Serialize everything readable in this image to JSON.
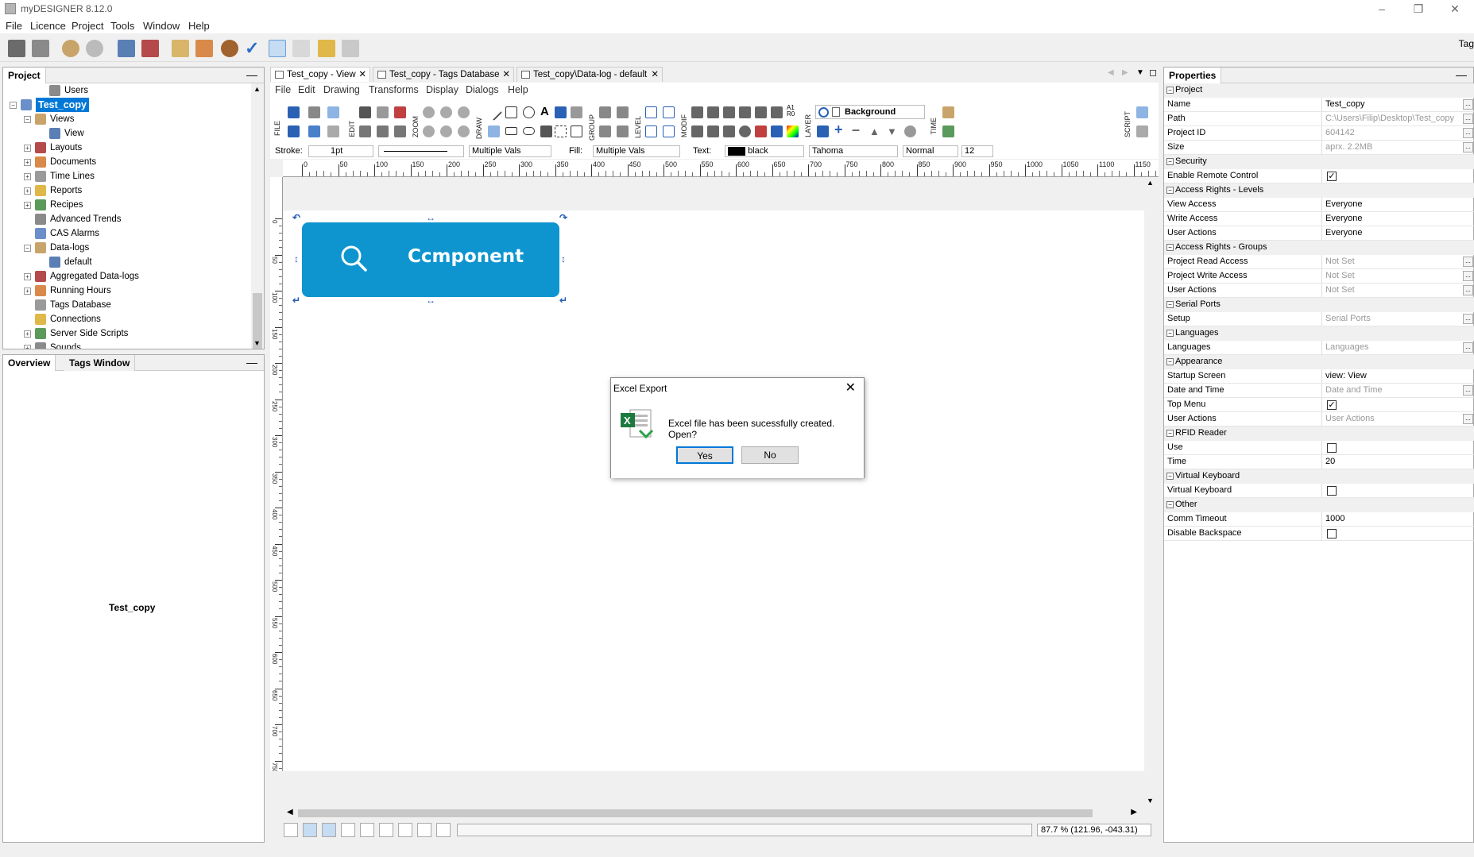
{
  "window": {
    "title": "myDESIGNER 8.12.0"
  },
  "menu": [
    "File",
    "Licence",
    "Project",
    "Tools",
    "Window",
    "Help"
  ],
  "toolbar": {
    "tag_label": "Tag"
  },
  "project_panel": {
    "tab": "Project",
    "tree": [
      {
        "label": "Users",
        "indent": 2,
        "expand": ""
      },
      {
        "label": "Test_copy",
        "indent": 0,
        "expand": "-",
        "selected": true
      },
      {
        "label": "Views",
        "indent": 1,
        "expand": "-"
      },
      {
        "label": "View",
        "indent": 2,
        "expand": ""
      },
      {
        "label": "Layouts",
        "indent": 1,
        "expand": "+"
      },
      {
        "label": "Documents",
        "indent": 1,
        "expand": "+"
      },
      {
        "label": "Time Lines",
        "indent": 1,
        "expand": "+"
      },
      {
        "label": "Reports",
        "indent": 1,
        "expand": "+"
      },
      {
        "label": "Recipes",
        "indent": 1,
        "expand": "+"
      },
      {
        "label": "Advanced Trends",
        "indent": 1,
        "expand": ""
      },
      {
        "label": "CAS Alarms",
        "indent": 1,
        "expand": ""
      },
      {
        "label": "Data-logs",
        "indent": 1,
        "expand": "-"
      },
      {
        "label": "default",
        "indent": 2,
        "expand": ""
      },
      {
        "label": "Aggregated Data-logs",
        "indent": 1,
        "expand": "+"
      },
      {
        "label": "Running Hours",
        "indent": 1,
        "expand": "+"
      },
      {
        "label": "Tags Database",
        "indent": 1,
        "expand": ""
      },
      {
        "label": "Connections",
        "indent": 1,
        "expand": ""
      },
      {
        "label": "Server Side Scripts",
        "indent": 1,
        "expand": "+"
      },
      {
        "label": "Sounds",
        "indent": 1,
        "expand": "+"
      }
    ]
  },
  "overview_panel": {
    "tabs": [
      "Overview",
      "Tags Window"
    ],
    "content": "Test_copy"
  },
  "doc_tabs": [
    {
      "label": "Test_copy - View",
      "active": true
    },
    {
      "label": "Test_copy - Tags Database",
      "active": false
    },
    {
      "label": "Test_copy\\Data-log - default",
      "active": false
    }
  ],
  "inner_menu": [
    "File",
    "Edit",
    "Drawing",
    "Transforms",
    "Display",
    "Dialogs",
    "Help"
  ],
  "draw_groups": [
    "FILE",
    "EDIT",
    "ZOOM",
    "DRAW",
    "GROUP",
    "LEVEL",
    "MODIF",
    "LAYER",
    "TIME",
    "SCRIPT"
  ],
  "layer_name": "Background",
  "style_bar": {
    "stroke_label": "Stroke:",
    "stroke_width": "1pt",
    "stroke_vals": "Multiple Vals",
    "fill_label": "Fill:",
    "fill_vals": "Multiple Vals",
    "text_label": "Text:",
    "text_color": "black",
    "font": "Tahoma",
    "weight": "Normal",
    "size": "12"
  },
  "ruler_ticks": [
    "0",
    "50",
    "100",
    "150",
    "200",
    "250",
    "300",
    "350",
    "400",
    "450",
    "500",
    "550",
    "600",
    "650",
    "700",
    "750",
    "800",
    "850",
    "900",
    "950",
    "1000",
    "1050",
    "1100",
    "1150",
    "1200"
  ],
  "vruler_ticks": [
    "0",
    "50",
    "100",
    "150",
    "200",
    "250",
    "300",
    "350",
    "400",
    "450",
    "500",
    "550",
    "600",
    "650",
    "700",
    "750"
  ],
  "component": {
    "label": "Ccmponent",
    "color": "#0e95cf"
  },
  "status": {
    "zoom": "87.7 % (121.96, -043.31)"
  },
  "properties": {
    "tab": "Properties",
    "rows": [
      {
        "type": "cat",
        "label": "Project"
      },
      {
        "type": "row",
        "key": "Name",
        "value": "Test_copy",
        "dots": true
      },
      {
        "type": "row",
        "key": "Path",
        "value": "C:\\Users\\Filip\\Desktop\\Test_copy",
        "grey": true,
        "dots": true
      },
      {
        "type": "row",
        "key": "Project ID",
        "value": "604142",
        "grey": true,
        "dots": true
      },
      {
        "type": "row",
        "key": "Size",
        "value": "aprx. 2.2MB",
        "grey": true,
        "dots": true
      },
      {
        "type": "cat",
        "label": "Security"
      },
      {
        "type": "check",
        "key": "Enable Remote Control",
        "checked": true
      },
      {
        "type": "cat",
        "label": "Access Rights - Levels"
      },
      {
        "type": "row",
        "key": "View Access",
        "value": "Everyone"
      },
      {
        "type": "row",
        "key": "Write Access",
        "value": "Everyone"
      },
      {
        "type": "row",
        "key": "User Actions",
        "value": "Everyone"
      },
      {
        "type": "cat",
        "label": "Access Rights - Groups"
      },
      {
        "type": "row",
        "key": "Project Read Access",
        "value": "Not Set",
        "grey": true,
        "dots": true
      },
      {
        "type": "row",
        "key": "Project Write Access",
        "value": "Not Set",
        "grey": true,
        "dots": true
      },
      {
        "type": "row",
        "key": "User Actions",
        "value": "Not Set",
        "grey": true,
        "dots": true
      },
      {
        "type": "cat",
        "label": "Serial Ports"
      },
      {
        "type": "row",
        "key": "Setup",
        "value": "Serial Ports",
        "grey": true,
        "dots": true
      },
      {
        "type": "cat",
        "label": "Languages"
      },
      {
        "type": "row",
        "key": "Languages",
        "value": "Languages",
        "grey": true,
        "dots": true
      },
      {
        "type": "cat",
        "label": "Appearance"
      },
      {
        "type": "row",
        "key": "Startup Screen",
        "value": "view: View"
      },
      {
        "type": "row",
        "key": "Date and Time",
        "value": "Date and Time",
        "grey": true,
        "dots": true
      },
      {
        "type": "check",
        "key": "Top Menu",
        "checked": true
      },
      {
        "type": "row",
        "key": "User Actions",
        "value": "User Actions",
        "grey": true,
        "dots": true
      },
      {
        "type": "cat",
        "label": "RFID Reader"
      },
      {
        "type": "check",
        "key": "Use",
        "checked": false
      },
      {
        "type": "row",
        "key": "Time",
        "value": "20"
      },
      {
        "type": "cat",
        "label": "Virtual Keyboard"
      },
      {
        "type": "check",
        "key": "Virtual Keyboard",
        "checked": false
      },
      {
        "type": "cat",
        "label": "Other"
      },
      {
        "type": "row",
        "key": "Comm Timeout",
        "value": "1000"
      },
      {
        "type": "check",
        "key": "Disable Backspace",
        "checked": false
      }
    ]
  },
  "dialog": {
    "title": "Excel Export",
    "message": "Excel file has been sucessfully created. Open?",
    "yes": "Yes",
    "no": "No"
  }
}
